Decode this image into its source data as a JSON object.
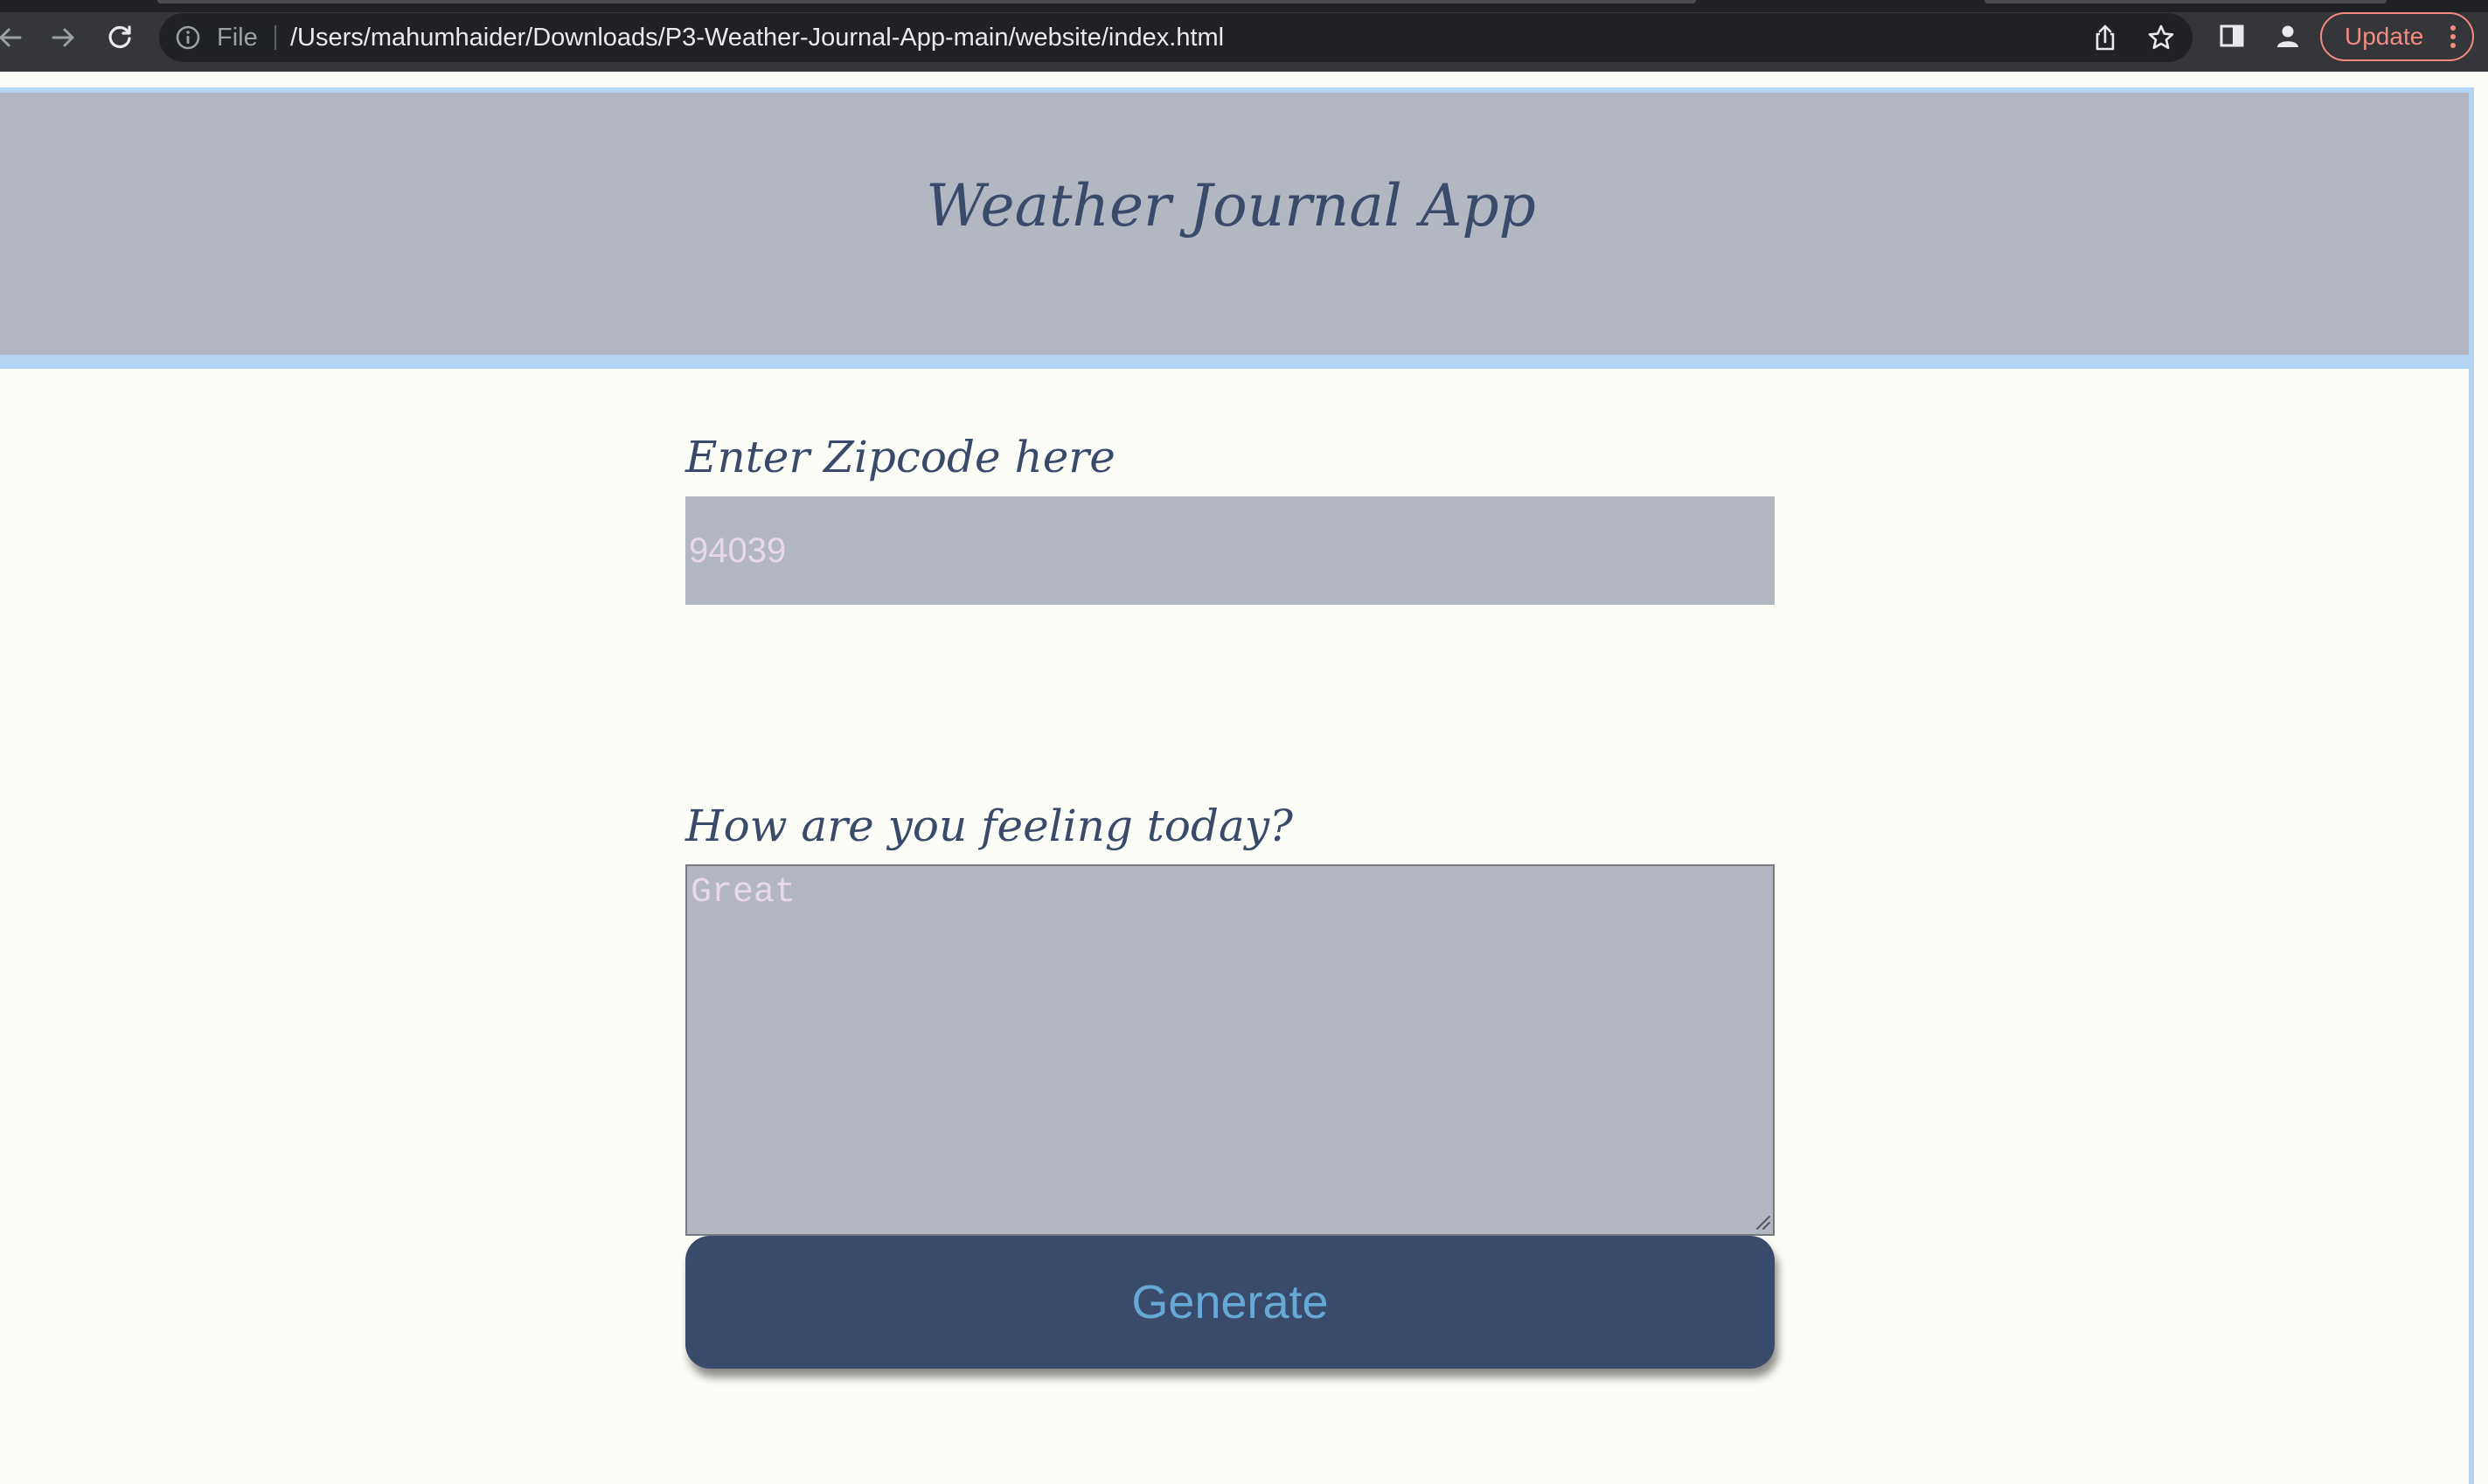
{
  "browser": {
    "file_label": "File",
    "url": "/Users/mahumhaider/Downloads/P3-Weather-Journal-App-main/website/index.html",
    "update_label": "Update",
    "icons": [
      "back-arrow-icon",
      "forward-arrow-icon",
      "reload-icon",
      "info-icon",
      "share-icon",
      "star-icon",
      "side-panel-icon",
      "profile-icon",
      "more-vert-icon"
    ]
  },
  "page": {
    "title": "Weather Journal App",
    "zip_label": "Enter Zipcode here",
    "zip_placeholder": "94039",
    "feel_label": "How are you feeling today?",
    "feel_placeholder": "Great",
    "generate_label": "Generate"
  },
  "colors": {
    "header_bg": "#b2b7c1",
    "header_border": "#b3d4f5",
    "title_text": "#3a4a6b",
    "page_bg": "#fdfdf8",
    "button_bg": "#3a4a6b",
    "button_text": "#66a8d6",
    "placeholder_text": "#e8d8ea",
    "update_accent": "#f28b82"
  }
}
